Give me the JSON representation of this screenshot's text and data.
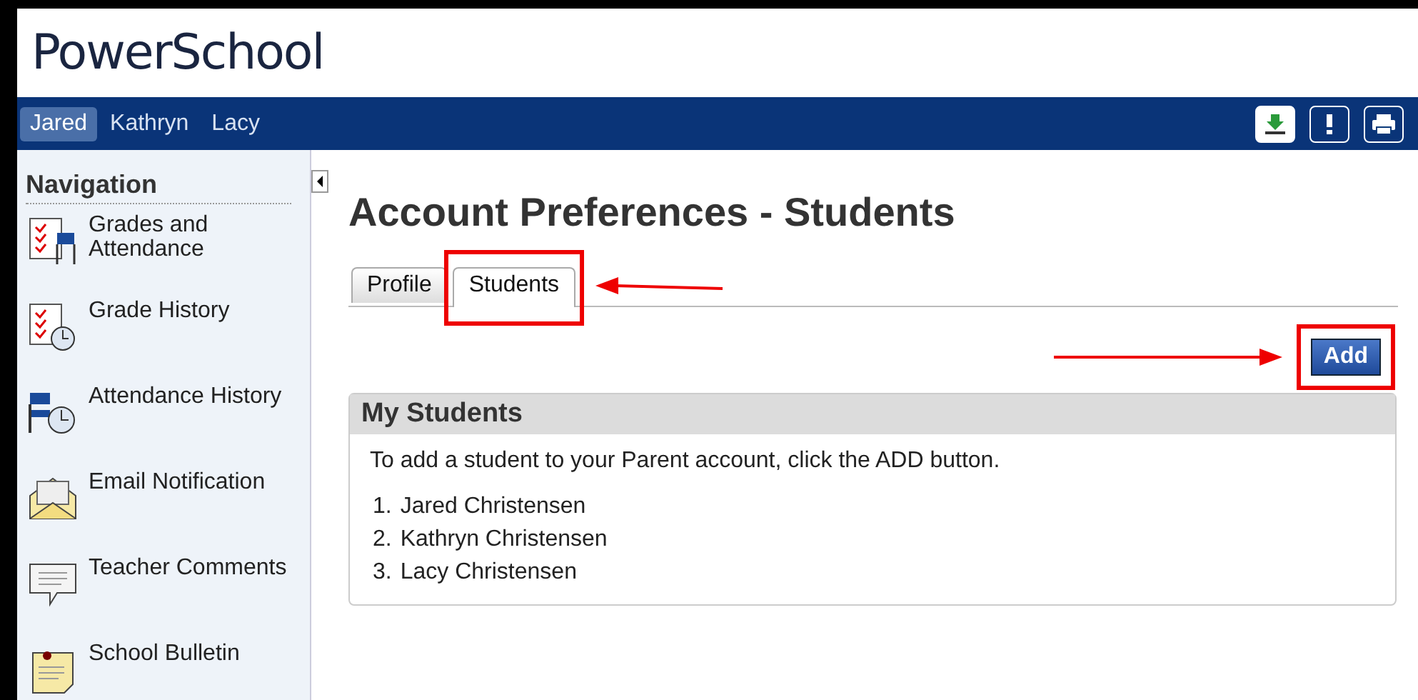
{
  "logo": "PowerSchool",
  "students_bar": [
    {
      "label": "Jared",
      "selected": true
    },
    {
      "label": "Kathryn",
      "selected": false
    },
    {
      "label": "Lacy",
      "selected": false
    }
  ],
  "toolbar_icons": [
    {
      "kind": "download"
    },
    {
      "kind": "alert"
    },
    {
      "kind": "print"
    }
  ],
  "navigation": {
    "title": "Navigation",
    "items": [
      {
        "label": "Grades and Attendance",
        "kind": "grades"
      },
      {
        "label": "Grade History",
        "kind": "grade-history"
      },
      {
        "label": "Attendance History",
        "kind": "attendance-history"
      },
      {
        "label": "Email Notification",
        "kind": "email"
      },
      {
        "label": "Teacher Comments",
        "kind": "comments"
      },
      {
        "label": "School Bulletin",
        "kind": "bulletin"
      }
    ]
  },
  "page_title": "Account Preferences - Students",
  "tabs": [
    {
      "label": "Profile",
      "selected": false,
      "highlighted": false
    },
    {
      "label": "Students",
      "selected": true,
      "highlighted": true
    }
  ],
  "add_button": {
    "label": "Add",
    "highlighted": true
  },
  "panel": {
    "title": "My Students",
    "intro": "To add a student to your Parent account, click the ADD button.",
    "students": [
      {
        "number": "1.",
        "name": "Jared Christensen"
      },
      {
        "number": "2.",
        "name": "Kathryn Christensen"
      },
      {
        "number": "3.",
        "name": "Lacy Christensen"
      }
    ]
  }
}
